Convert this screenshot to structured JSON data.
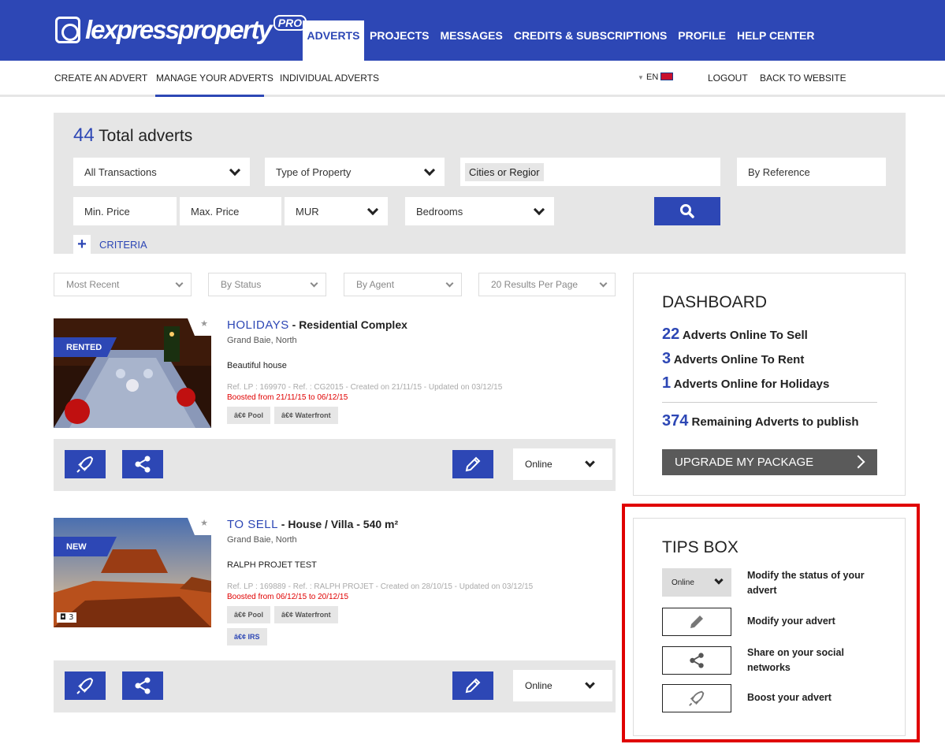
{
  "brand": {
    "logo_text": "lexpressproperty",
    "logo_badge": "PRO"
  },
  "main_nav": [
    "ADVERTS",
    "PROJECTS",
    "MESSAGES",
    "CREDITS & SUBSCRIPTIONS",
    "PROFILE",
    "HELP CENTER"
  ],
  "sub_nav": {
    "create": "CREATE AN ADVERT",
    "manage": "MANAGE YOUR ADVERTS",
    "individual": "INDIVIDUAL ADVERTS",
    "lang": "EN",
    "logout": "LOGOUT",
    "back": "BACK TO WEBSITE"
  },
  "search": {
    "total_count": "44",
    "total_label": "Total adverts",
    "transactions": "All Transactions",
    "property_type": "Type of Property",
    "cities": "Cities or Regior",
    "reference": "By Reference",
    "min_price": "Min. Price",
    "max_price": "Max. Price",
    "currency": "MUR",
    "bedrooms": "Bedrooms",
    "criteria": "CRITERIA"
  },
  "filters": {
    "sort": "Most Recent",
    "status": "By Status",
    "agent": "By Agent",
    "per_page": "20 Results Per Page"
  },
  "listings": [
    {
      "ribbon": "RENTED",
      "category": "HOLIDAYS",
      "title": " - Residential Complex",
      "location": "Grand Baie, North",
      "description": "Beautiful house",
      "ref": "Ref. LP : 169970 - Ref. : CG2015 - Created on 21/11/15 - Updated on 03/12/15",
      "boost": "Boosted from 21/11/15 to 06/12/15",
      "tags": [
        "â€¢ Pool",
        "â€¢ Waterfront"
      ],
      "status": "Online"
    },
    {
      "ribbon": "NEW",
      "category": "TO SELL",
      "title": " - House / Villa - 540 m²",
      "location": "Grand Baie, North",
      "description": "RALPH PROJET TEST",
      "ref": "Ref. LP : 169889 - Ref. : RALPH PROJET - Created on 28/10/15 - Updated on 03/12/15",
      "boost": "Boosted from 06/12/15 to 20/12/15",
      "tags": [
        "â€¢ Pool",
        "â€¢ Waterfront"
      ],
      "tags2": [
        "â€¢ IRS"
      ],
      "photo_count": "3",
      "status": "Online"
    }
  ],
  "dashboard": {
    "title": "DASHBOARD",
    "rows": [
      {
        "n": "22",
        "label": "Adverts Online To Sell"
      },
      {
        "n": "3",
        "label": "Adverts Online To Rent"
      },
      {
        "n": "1",
        "label": "Adverts Online for Holidays"
      }
    ],
    "remaining_n": "374",
    "remaining_label": "Remaining Adverts to publish",
    "upgrade": "UPGRADE MY PACKAGE"
  },
  "tips": {
    "title": "TIPS BOX",
    "status_sample": "Online",
    "items": [
      "Modify the status of your advert",
      "Modify your advert",
      "Share on your social networks",
      "Boost your advert"
    ]
  },
  "colors": {
    "brand_blue": "#2d47b5",
    "highlight": "#e00000"
  }
}
